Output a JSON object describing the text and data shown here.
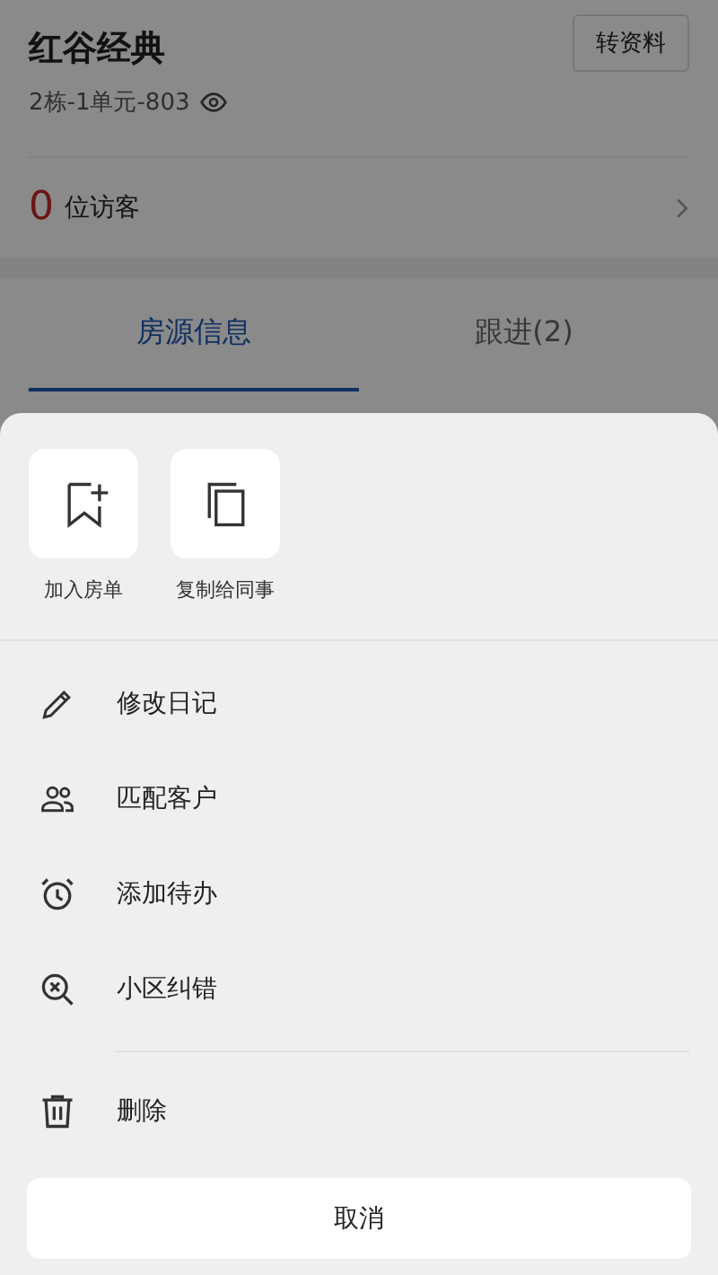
{
  "header": {
    "title": "红谷经典",
    "transfer_button": "转资料",
    "unit": "2栋-1单元-803"
  },
  "visitors": {
    "count": "0",
    "label": "位访客"
  },
  "tabs": [
    {
      "label": "房源信息",
      "selected": true
    },
    {
      "label": "跟进(2)",
      "selected": false
    }
  ],
  "sheet": {
    "quick_actions": [
      "加入房单",
      "复制给同事"
    ],
    "menu": [
      "修改日记",
      "匹配客户",
      "添加待办",
      "小区纠错"
    ],
    "delete": "删除",
    "cancel": "取消"
  }
}
